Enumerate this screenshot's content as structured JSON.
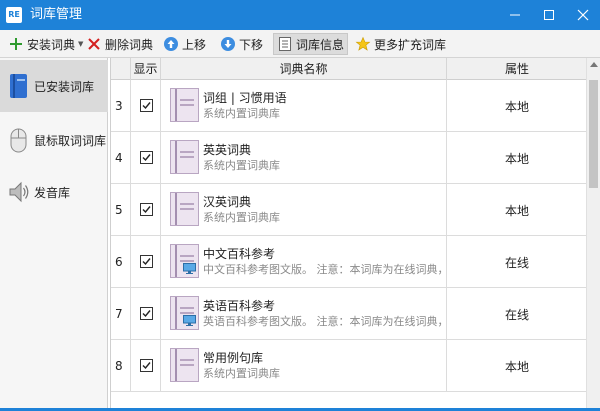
{
  "window": {
    "app_icon_text": "RE",
    "title": "词库管理"
  },
  "toolbar": {
    "install_label": "安装词典",
    "delete_label": "删除词典",
    "up_label": "上移",
    "down_label": "下移",
    "info_label": "词库信息",
    "more_label": "更多扩充词库"
  },
  "sidebar": {
    "items": [
      {
        "label": "已安装词库",
        "icon": "book-icon",
        "selected": true
      },
      {
        "label": "鼠标取词词库",
        "icon": "mouse-icon",
        "selected": false
      },
      {
        "label": "发音库",
        "icon": "speaker-icon",
        "selected": false
      }
    ]
  },
  "table": {
    "headers": {
      "show": "显示",
      "name": "词典名称",
      "attr": "属性"
    },
    "rows": [
      {
        "num": "3",
        "checked": true,
        "name": "词组 | 习惯用语",
        "desc": "系统内置词典库",
        "attr": "本地",
        "online_badge": false
      },
      {
        "num": "4",
        "checked": true,
        "name": "英英词典",
        "desc": "系统内置词典库",
        "attr": "本地",
        "online_badge": false
      },
      {
        "num": "5",
        "checked": true,
        "name": "汉英词典",
        "desc": "系统内置词典库",
        "attr": "本地",
        "online_badge": false
      },
      {
        "num": "6",
        "checked": true,
        "name": "中文百科参考",
        "desc": "中文百科参考图文版。    注意：本词库为在线词典，",
        "attr": "在线",
        "online_badge": true
      },
      {
        "num": "7",
        "checked": true,
        "name": "英语百科参考",
        "desc": "英语百科参考图文版。    注意：本词库为在线词典，",
        "attr": "在线",
        "online_badge": true
      },
      {
        "num": "8",
        "checked": true,
        "name": "常用例句库",
        "desc": "系统内置词典库",
        "attr": "本地",
        "online_badge": false
      }
    ]
  },
  "colors": {
    "accent": "#1e82d8",
    "toolbar_bg": "#f3f3f3",
    "book": "#ede4f0"
  }
}
